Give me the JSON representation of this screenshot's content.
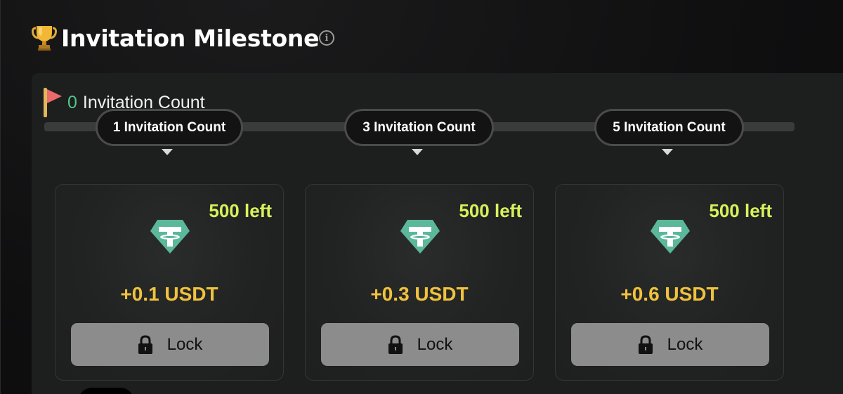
{
  "header": {
    "title": "Invitation Milestone",
    "trophy_icon": "trophy-icon",
    "info_icon": "info-icon"
  },
  "progress": {
    "current_count": "0",
    "label": "Invitation Count",
    "flag_icon": "flag-icon"
  },
  "milestones": [
    {
      "label": "1 Invitation Count",
      "left": "500 left",
      "reward": "+0.1 USDT",
      "button": "Lock"
    },
    {
      "label": "3 Invitation Count",
      "left": "500 left",
      "reward": "+0.3 USDT",
      "button": "Lock"
    },
    {
      "label": "5 Invitation Count",
      "left": "500 left",
      "reward": "+0.6 USDT",
      "button": "Lock"
    }
  ],
  "colors": {
    "accent_green": "#4ec98a",
    "left_badge": "#d7f25a",
    "reward_gold": "#f0c23d",
    "usdt_teal": "#5bb89a",
    "lock_button": "#8c8c8c"
  }
}
